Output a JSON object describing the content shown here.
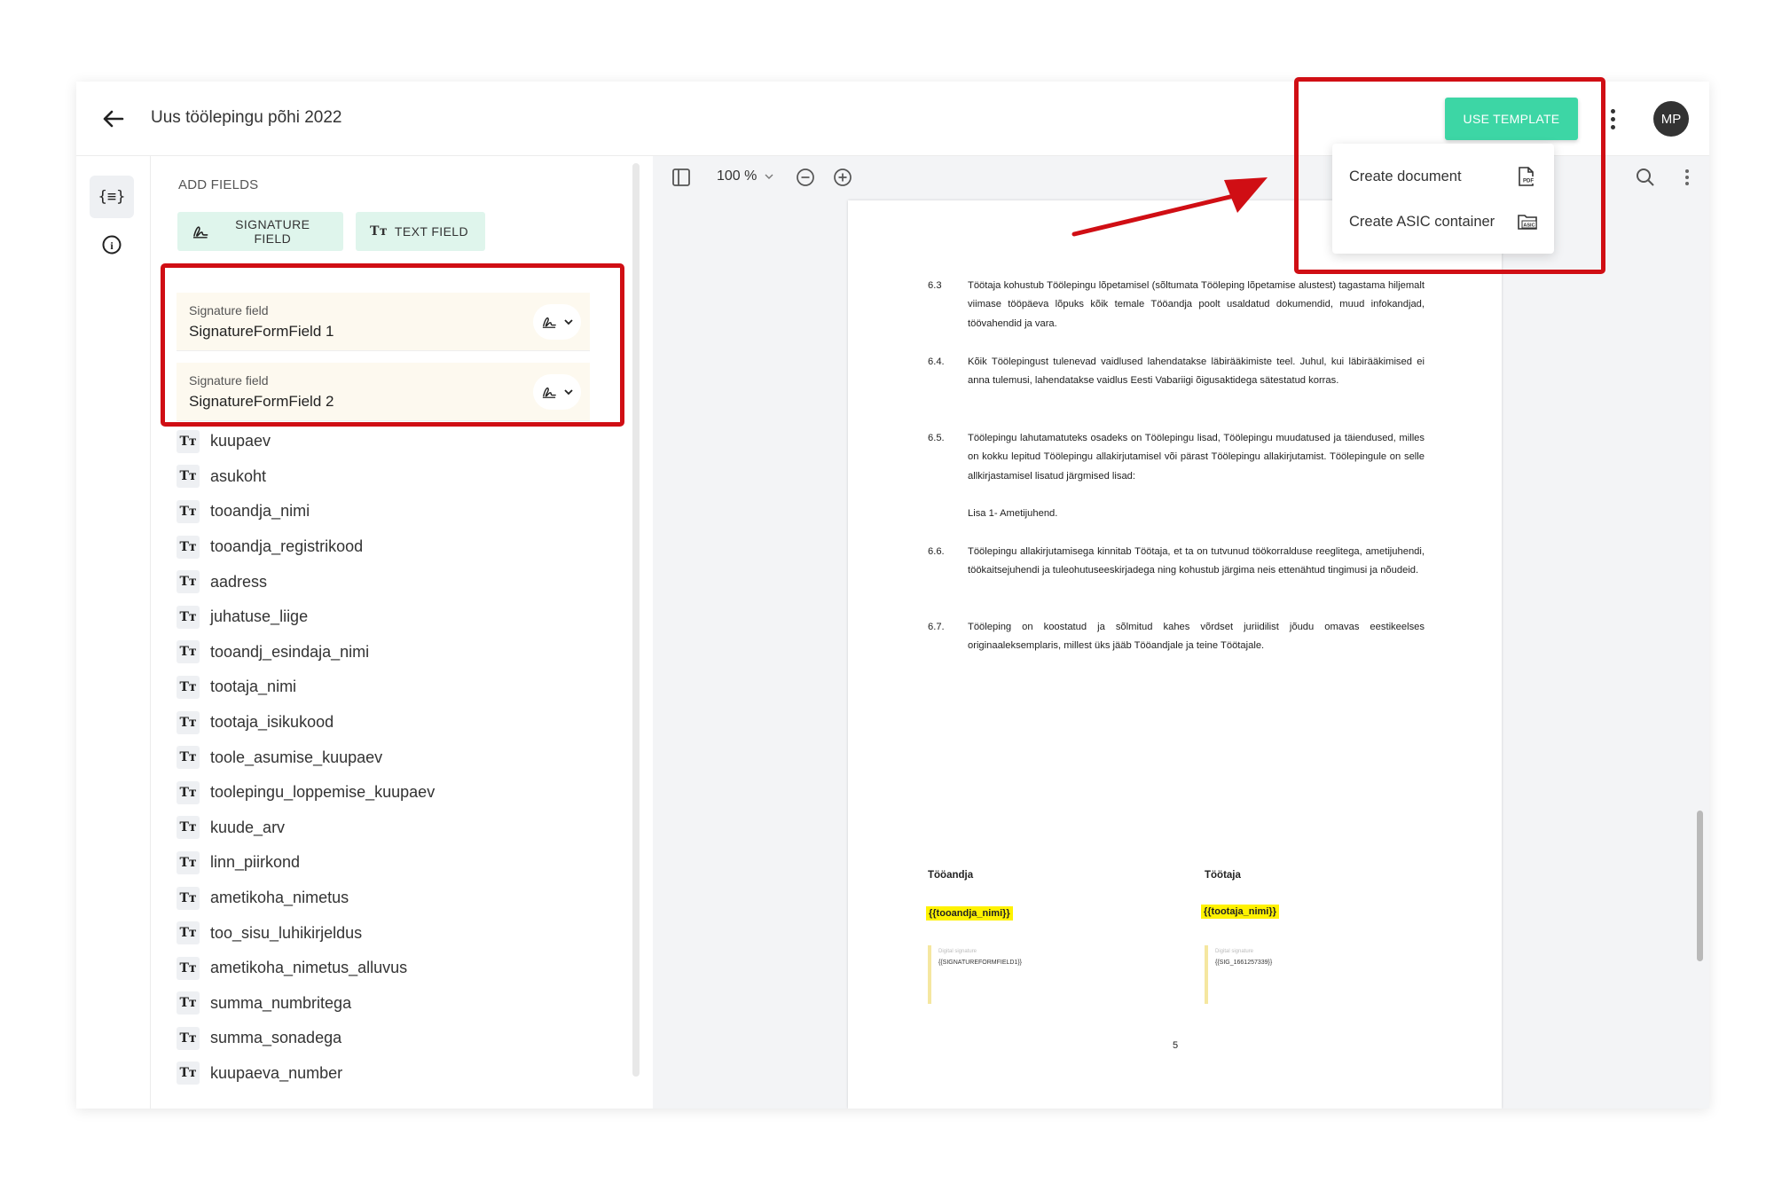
{
  "header": {
    "title": "Uus töölepingu põhi 2022",
    "use_template_label": "USE TEMPLATE",
    "avatar_initials": "MP"
  },
  "dropdown": {
    "items": [
      {
        "label": "Create document",
        "icon_text": "PDF"
      },
      {
        "label": "Create ASIC container",
        "icon_text": "ASIC"
      }
    ]
  },
  "rail": {
    "fields_icon": "{≡}",
    "info_icon": "i"
  },
  "panel": {
    "title": "ADD FIELDS",
    "signature_button": "SIGNATURE FIELD",
    "text_button": "TEXT FIELD",
    "text_icon": "Tт",
    "signature_fields": [
      {
        "kind": "Signature field",
        "name": "SignatureFormField 1"
      },
      {
        "kind": "Signature field",
        "name": "SignatureFormField 2"
      }
    ],
    "text_fields": [
      "kuupaev",
      "asukoht",
      "tooandja_nimi",
      "tooandja_registrikood",
      "aadress",
      "juhatuse_liige",
      "tooandj_esindaja_nimi",
      "tootaja_nimi",
      "tootaja_isikukood",
      "toole_asumise_kuupaev",
      "toolepingu_loppemise_kuupaev",
      "kuude_arv",
      "linn_piirkond",
      "ametikoha_nimetus",
      "too_sisu_luhikirjeldus",
      "ametikoha_nimetus_alluvus",
      "summa_numbritega",
      "summa_sonadega",
      "kuupaeva_number"
    ]
  },
  "toolbar": {
    "zoom": "100 %"
  },
  "document": {
    "clauses": [
      {
        "num": "6.3",
        "text": "Töötaja kohustub Töölepingu lõpetamisel (sõltumata Tööleping lõpetamise alustest) tagastama hiljemalt viimase tööpäeva lõpuks kõik temale Tööandja poolt usaldatud dokumendid, muud infokandjad, töövahendid ja vara."
      },
      {
        "num": "6.4.",
        "text": "Kõik Töölepingust tulenevad vaidlused lahendatakse läbirääkimiste teel. Juhul, kui läbirääkimised ei anna tulemusi, lahendatakse vaidlus Eesti Vabariigi õigusaktidega sätestatud korras."
      },
      {
        "num": "6.5.",
        "text": "Töölepingu lahutamatuteks osadeks on Töölepingu lisad, Töölepingu muudatused ja täiendused, milles on kokku lepitud Töölepingu allakirjutamisel või pärast Töölepingu allakirjutamist. Töölepingule on selle allkirjastamisel lisatud järgmised lisad:"
      },
      {
        "num": "",
        "text": "Lisa 1-  Ametijuhend."
      },
      {
        "num": "6.6.",
        "text": "Töölepingu allakirjutamisega kinnitab Töötaja, et ta on tutvunud töökorralduse reeglitega, ametijuhendi, töökaitsejuhendi ja tuleohutuseeskirjadega ning kohustub järgima neis ettenähtud tingimusi ja nõudeid."
      },
      {
        "num": "6.7.",
        "text": "Tööleping on koostatud ja sõlmitud kahes võrdset juriidilist jõudu omavas eestikeelses originaaleksemplaris, millest üks jääb Tööandjale ja teine Töötajale."
      }
    ],
    "employer_label": "Tööandja",
    "employee_label": "Töötaja",
    "employer_placeholder": "{{tooandja_nimi}}",
    "employee_placeholder": "{{tootaja_nimi}}",
    "sig1_label": "Digital signature",
    "sig1_value": "{{SIGNATUREFORMFIELD1}}",
    "sig2_label": "Digital signature",
    "sig2_value": "{{SIG_1661257339}}",
    "page_number": "5"
  },
  "colors": {
    "accent": "#3dd6a5",
    "annotation": "#d00e14",
    "highlight": "#fff200"
  }
}
